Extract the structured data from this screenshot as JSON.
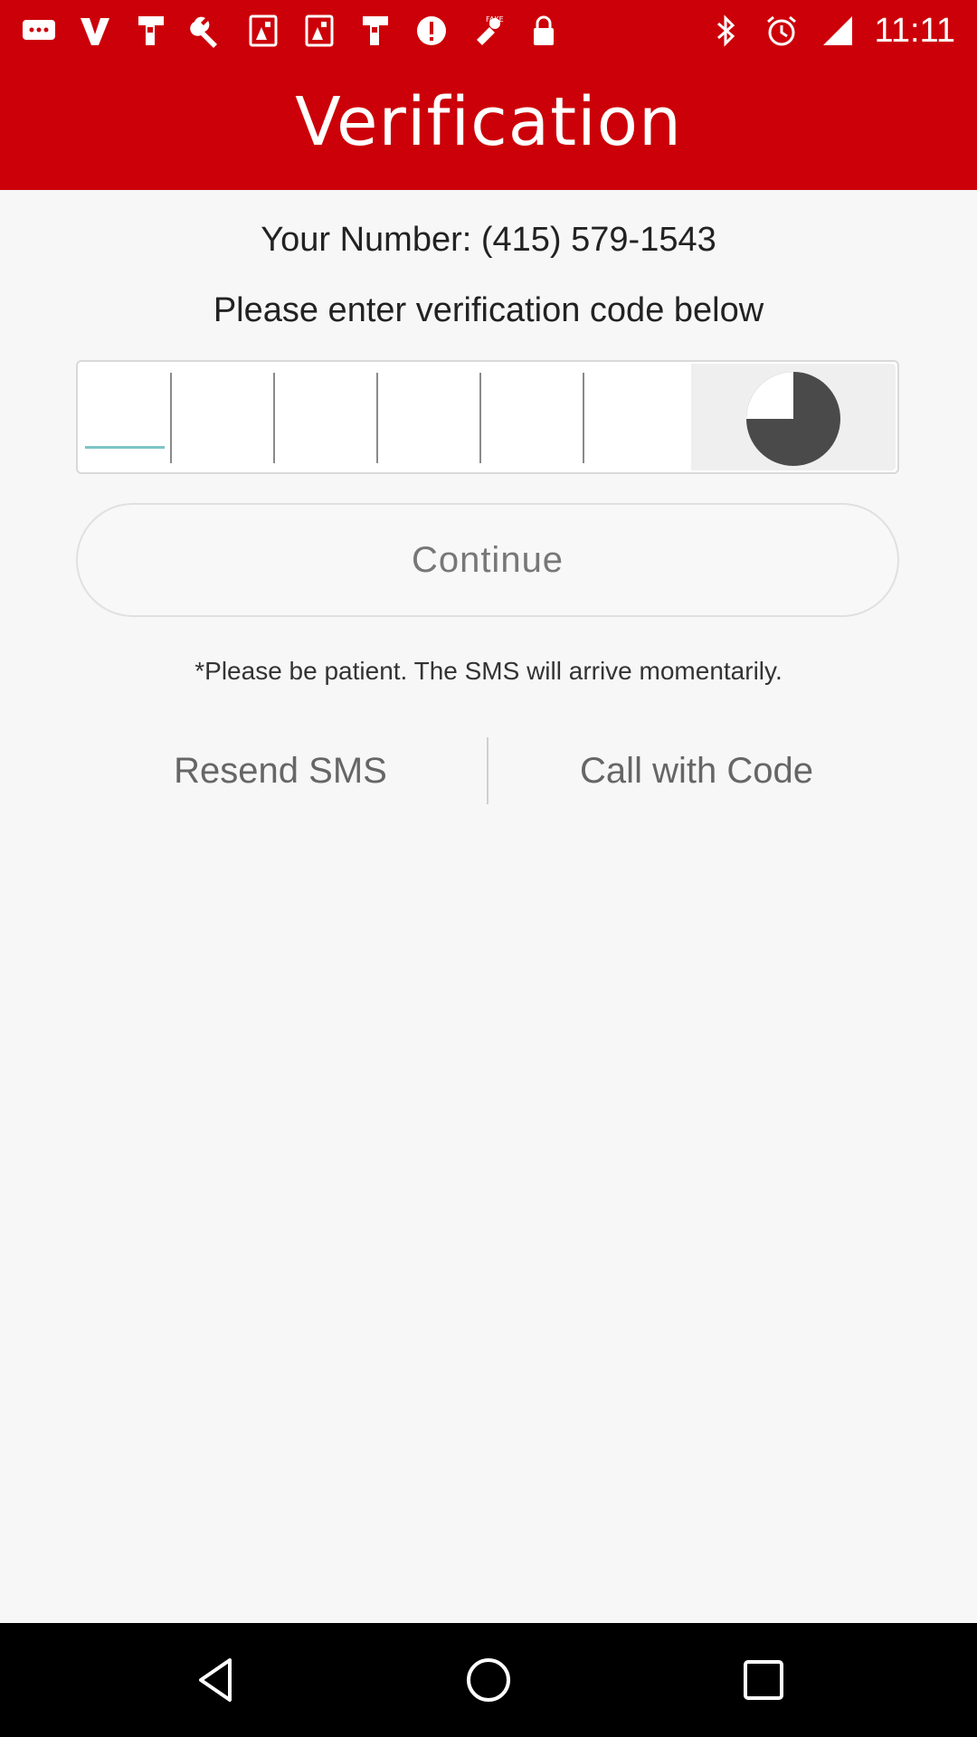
{
  "status_bar": {
    "time": "11:11",
    "left_icons": [
      "message-icon",
      "v-icon",
      "app-icon",
      "wrench-icon",
      "photo-icon",
      "photo-icon",
      "app-icon",
      "alert-icon",
      "fake-gps-icon",
      "lock-icon"
    ],
    "right_icons": [
      "bluetooth-icon",
      "alarm-icon",
      "signal-icon"
    ]
  },
  "header": {
    "title": "Verification",
    "color": "#cc0008"
  },
  "content": {
    "your_number": "Your Number: (415) 579-1543",
    "prompt": "Please enter verification code below",
    "code_digits": [
      "",
      "",
      "",
      "",
      "",
      ""
    ],
    "timer_progress": 0.25,
    "continue_label": "Continue",
    "patient_note": "*Please be patient. The SMS will arrive momentarily.",
    "resend_label": "Resend SMS",
    "call_label": "Call with Code"
  },
  "nav": {
    "back_icon": "back-icon",
    "home_icon": "home-icon",
    "recent_icon": "recent-apps-icon"
  }
}
